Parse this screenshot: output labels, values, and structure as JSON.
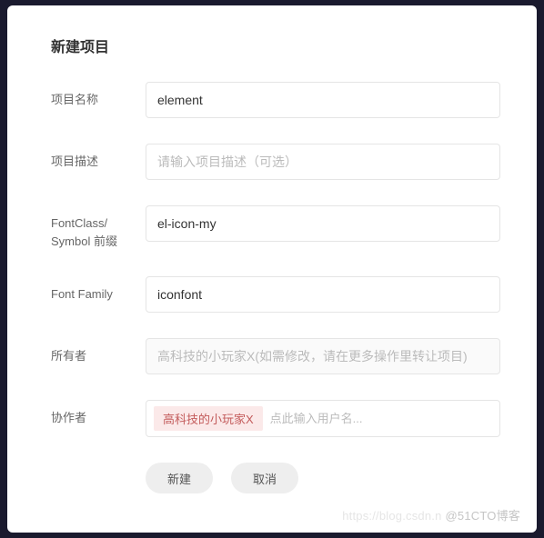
{
  "modal": {
    "title": "新建项目"
  },
  "form": {
    "name": {
      "label": "项目名称",
      "value": "element"
    },
    "desc": {
      "label": "项目描述",
      "placeholder": "请输入项目描述（可选）",
      "value": ""
    },
    "prefix": {
      "label": "FontClass/ Symbol 前缀",
      "value": "el-icon-my"
    },
    "fontfamily": {
      "label": "Font Family",
      "value": "iconfont"
    },
    "owner": {
      "label": "所有者",
      "value": "高科技的小玩家X(如需修改，请在更多操作里转让项目)"
    },
    "collab": {
      "label": "协作者",
      "tag": "高科技的小玩家X",
      "placeholder": "点此输入用户名..."
    }
  },
  "buttons": {
    "create": "新建",
    "cancel": "取消"
  },
  "watermark": {
    "faint": "https://blog.csdn.n",
    "text": "@51CTO博客"
  }
}
